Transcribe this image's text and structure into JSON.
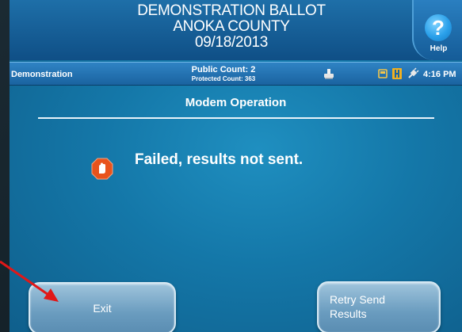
{
  "header": {
    "title_line1": "DEMONSTRATION BALLOT",
    "title_line2": "ANOKA COUNTY",
    "title_line3": "09/18/2013",
    "help_label": "Help",
    "help_glyph": "?"
  },
  "statusbar": {
    "mode": "Demonstration",
    "public_count": "Public Count: 2",
    "protected_count": "Protected Count: 363",
    "time": "4:16 PM",
    "icons": [
      "printer-icon",
      "memory-card-icon",
      "disk-icon",
      "power-plug-icon"
    ]
  },
  "main": {
    "title": "Modem Operation",
    "message": "Failed, results not sent.",
    "status_icon": "stop-hand-icon"
  },
  "buttons": {
    "exit_label": "Exit",
    "retry_label_line1": "Retry Send",
    "retry_label_line2": "Results"
  },
  "colors": {
    "screen": "#1477a8",
    "header": "#0f4f86",
    "stop_icon": "#e8531c",
    "annotation_arrow": "#e01818",
    "button": "#7aa8c9"
  }
}
